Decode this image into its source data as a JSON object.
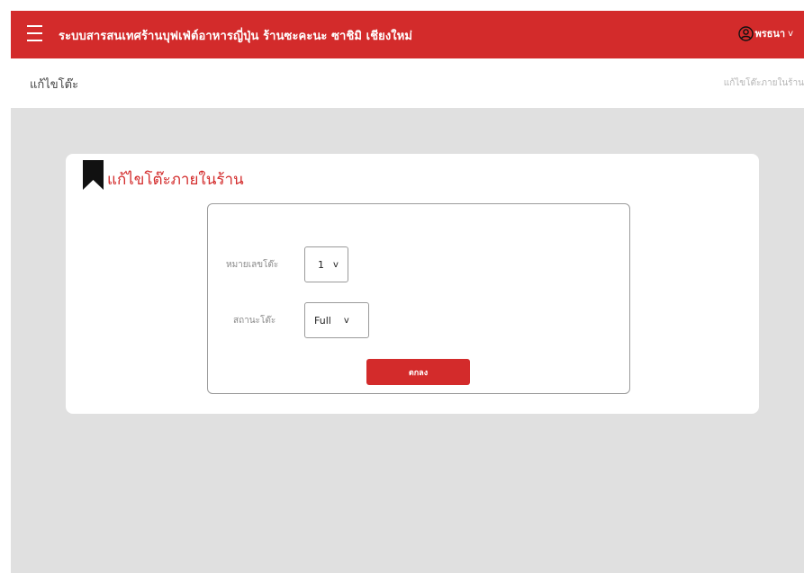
{
  "header": {
    "app_title": "ระบบสารสนเทศร้านบุฟเฟ่ต์อาหารญี่ปุ่น ร้านซะคะนะ ซาชิมิ เชียงใหม่",
    "user_name": "พรธนา",
    "user_chevron": "v",
    "menu_icon": "hamburger-icon",
    "user_icon": "user-circle-icon"
  },
  "breadcrumb": {
    "page": "แก้ไขโต๊ะ",
    "path": "แก้ไขโต๊ะภายในร้าน"
  },
  "card": {
    "title": "แก้ไขโต๊ะภายในร้าน",
    "title_icon": "bookmark-icon"
  },
  "form": {
    "table_number_label": "หมายเลขโต๊ะ",
    "table_number_value": "1",
    "table_number_arrow": "v",
    "status_label": "สถานะโต๊ะ",
    "status_value": "Full",
    "status_arrow": "v",
    "submit_label": "ตกลง"
  },
  "colors": {
    "brand": "#d32b2b",
    "page_bg": "#e0e0e0"
  }
}
